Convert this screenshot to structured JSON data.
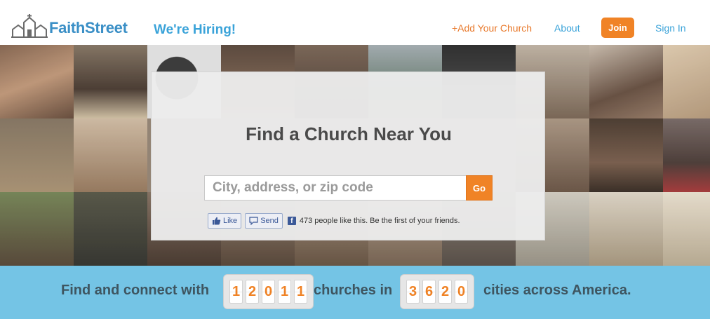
{
  "header": {
    "logo_text": "FaithStreet",
    "hiring": "We're Hiring!",
    "nav": {
      "add_church": "+Add Your Church",
      "about": "About",
      "join": "Join",
      "sign_in": "Sign In"
    }
  },
  "search_panel": {
    "title": "Find a Church Near You",
    "placeholder": "City, address, or zip code",
    "go_label": "Go",
    "facebook": {
      "like_label": "Like",
      "send_label": "Send",
      "social_text": "473 people like this. Be the first of your friends."
    }
  },
  "banner": {
    "prefix": "Find and connect with",
    "churches_digits": [
      "1",
      "2",
      "0",
      "1",
      "1"
    ],
    "middle": "churches in",
    "cities_digits": [
      "3",
      "6",
      "2",
      "0"
    ],
    "suffix": "cities across America."
  },
  "colors": {
    "brand_blue": "#3a8fc6",
    "accent_orange": "#f08326",
    "banner_blue": "#74c4e5"
  }
}
